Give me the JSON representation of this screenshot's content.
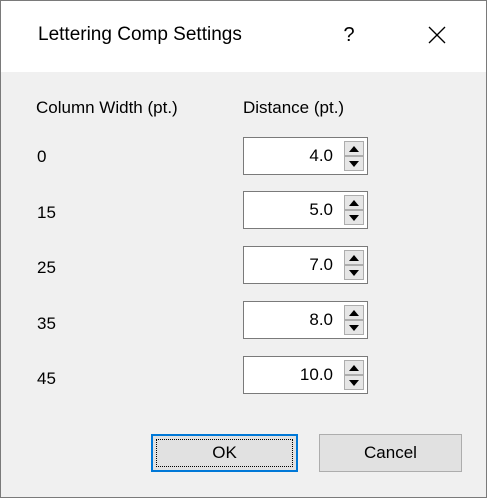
{
  "dialog": {
    "title": "Lettering Comp Settings",
    "help_label": "?",
    "close_icon": "close-icon"
  },
  "headers": {
    "column_width": "Column Width (pt.)",
    "distance": "Distance (pt.)"
  },
  "rows": [
    {
      "width": "0",
      "distance": "4.0"
    },
    {
      "width": "15",
      "distance": "5.0"
    },
    {
      "width": "25",
      "distance": "7.0"
    },
    {
      "width": "35",
      "distance": "8.0"
    },
    {
      "width": "45",
      "distance": "10.0"
    }
  ],
  "buttons": {
    "ok": "OK",
    "cancel": "Cancel"
  },
  "colors": {
    "focus_accent": "#0078d7",
    "dialog_bg": "#f0f0f0"
  }
}
